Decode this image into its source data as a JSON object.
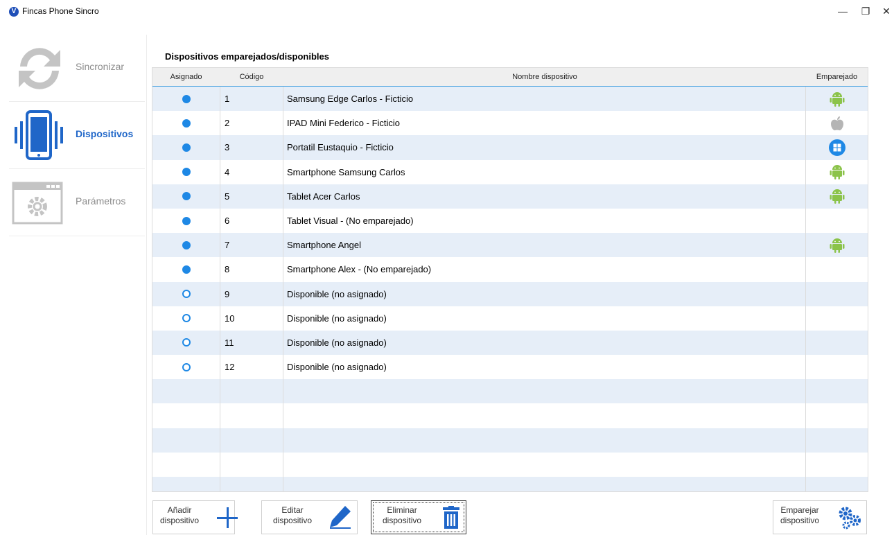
{
  "window": {
    "title": "Fincas Phone Sincro",
    "logo_letter": "V",
    "minimize": "—",
    "maximize": "❐",
    "close": "✕"
  },
  "sidebar": {
    "items": [
      {
        "label": "Sincronizar",
        "icon": "sync-icon",
        "active": false
      },
      {
        "label": "Dispositivos",
        "icon": "phone-icon",
        "active": true
      },
      {
        "label": "Parámetros",
        "icon": "settings-window-icon",
        "active": false
      }
    ]
  },
  "main": {
    "title": "Dispositivos emparejados/disponibles",
    "columns": {
      "assigned": "Asignado",
      "code": "Código",
      "name": "Nombre dispositivo",
      "paired": "Emparejado"
    },
    "rows": [
      {
        "assigned": true,
        "code": "1",
        "name": "Samsung Edge Carlos - Ficticio",
        "platform": "android"
      },
      {
        "assigned": true,
        "code": "2",
        "name": "IPAD Mini Federico - Ficticio",
        "platform": "apple"
      },
      {
        "assigned": true,
        "code": "3",
        "name": "Portatil Eustaquio - Ficticio",
        "platform": "windows"
      },
      {
        "assigned": true,
        "code": "4",
        "name": "Smartphone Samsung Carlos",
        "platform": "android"
      },
      {
        "assigned": true,
        "code": "5",
        "name": "Tablet Acer Carlos",
        "platform": "android"
      },
      {
        "assigned": true,
        "code": "6",
        "name": "Tablet Visual - (No emparejado)",
        "platform": ""
      },
      {
        "assigned": true,
        "code": "7",
        "name": "Smartphone Angel",
        "platform": "android"
      },
      {
        "assigned": true,
        "code": "8",
        "name": "Smartphone Alex - (No emparejado)",
        "platform": ""
      },
      {
        "assigned": false,
        "code": "9",
        "name": "Disponible (no asignado)",
        "platform": ""
      },
      {
        "assigned": false,
        "code": "10",
        "name": "Disponible (no asignado)",
        "platform": ""
      },
      {
        "assigned": false,
        "code": "11",
        "name": "Disponible (no asignado)",
        "platform": ""
      },
      {
        "assigned": false,
        "code": "12",
        "name": "Disponible (no asignado)",
        "platform": ""
      }
    ]
  },
  "buttons": {
    "add_line1": "Añadir",
    "add_line2": "dispositivo",
    "edit_line1": "Editar",
    "edit_line2": "dispositivo",
    "delete_line1": "Eliminar",
    "delete_line2": "dispositivo",
    "pair_line1": "Emparejar",
    "pair_line2": "dispositivo"
  },
  "colors": {
    "accent": "#1f66c8",
    "dot": "#1e88e5",
    "android": "#8bc34a",
    "row_alt": "#e6eef8"
  }
}
